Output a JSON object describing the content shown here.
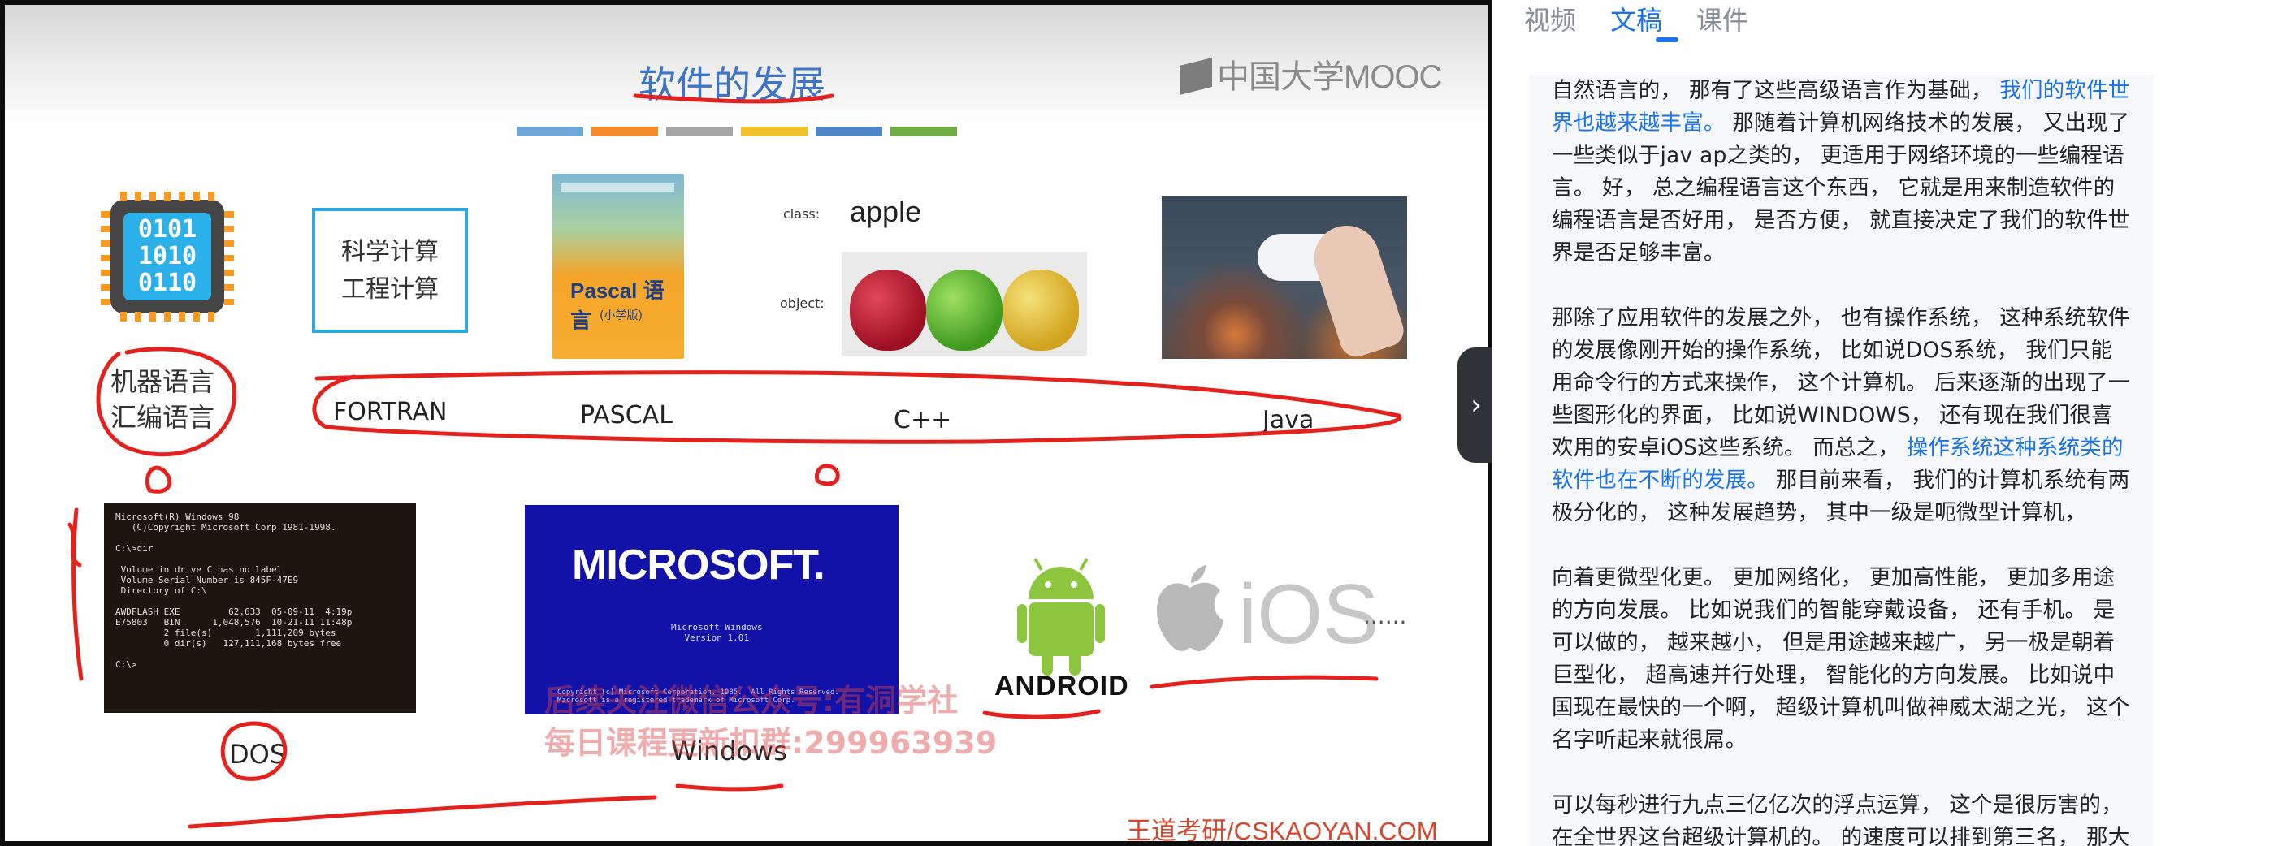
{
  "slide": {
    "title": "软件的发展",
    "logo_text": "中国大学MOOC",
    "color_bars": [
      "#6fa6d8",
      "#f28c28",
      "#a6a6a6",
      "#f2c12e",
      "#4f86c6",
      "#70ad47"
    ],
    "chip_binary": [
      "0101",
      "1010",
      "0110"
    ],
    "sci_box_lines": [
      "科学计算",
      "工程计算"
    ],
    "book_title": "Pascal 语言",
    "book_subtitle": "(小学版)",
    "class_label": "class:",
    "object_label": "object:",
    "apple_word": "apple",
    "machine_lang_lines": [
      "机器语言",
      "汇编语言"
    ],
    "languages": [
      "FORTRAN",
      "PASCAL",
      "C++",
      "Java"
    ],
    "dos_screen_text": "Microsoft(R) Windows 98\n   (C)Copyright Microsoft Corp 1981-1998.\n\nC:\\>dir\n\n Volume in drive C has no label\n Volume Serial Number is 845F-47E9\n Directory of C:\\\n\nAWDFLASH EXE         62,633  05-09-11  4:19p\nE75803   BIN      1,048,576  10-21-11 11:48p\n         2 file(s)        1,111,209 bytes\n         0 dir(s)   127,111,168 bytes free\n\nC:\\>",
    "ms_logo": "MICROSOFT.",
    "ms_sub": "Microsoft Windows\nVersion 1.01",
    "ms_copy": "Copyright (c) Microsoft Corporation, 1985.  All Rights Reserved.\nMicrosoft is a registered trademark of Microsoft Corp.",
    "android_word": "ANDROID",
    "ios_word": "iOS",
    "ellipsis": "......",
    "label_dos": "DOS",
    "label_windows": "Windows",
    "watermark_lines": [
      "后续关注微信公众号:有洞学社",
      "每日课程更新扣群:299963939"
    ],
    "footer_credit": "王道考研/CSKAOYAN.COM",
    "toggle_icon": "›"
  },
  "side": {
    "tabs": [
      "视频",
      "文稿",
      "课件"
    ],
    "active_tab": "文稿",
    "paragraphs": [
      [
        {
          "t": "自然语言的， 那有了这些高级语言作为基础， "
        },
        {
          "t": "我们的软件世界也越来越丰富。",
          "hl": true
        },
        {
          "t": " 那随着计算机网络技术的发展， 又出现了一些类似于jav ap之类的， 更适用于网络环境的一些编程语言。 好， 总之编程语言这个东西， 它就是用来制造软件的编程语言是否好用， 是否方便， 就直接决定了我们的软件世界是否足够丰富。"
        }
      ],
      [
        {
          "t": "那除了应用软件的发展之外， 也有操作系统， 这种系统软件的发展像刚开始的操作系统， 比如说DOS系统， 我们只能用命令行的方式来操作， 这个计算机。 后来逐渐的出现了一些图形化的界面， 比如说WINDOWS， 还有现在我们很喜欢用的安卓iOS这些系统。 而总之， "
        },
        {
          "t": "操作系统这种系统类的软件也在不断的发展。",
          "hl": true
        },
        {
          "t": " 那目前来看， 我们的计算机系统有两极分化的， 这种发展趋势， 其中一级是呃微型计算机，"
        }
      ],
      [
        {
          "t": "向着更微型化更。 更加网络化， 更加高性能， 更加多用途的方向发展。 比如说我们的智能穿戴设备， 还有手机。 是可以做的， 越来越小， 但是用途越来越广， 另一极是朝着巨型化， 超高速并行处理， 智能化的方向发展。 比如说中国现在最快的一个啊， 超级计算机叫做神威太湖之光， 这个名字听起来就很屌。"
        }
      ],
      [
        {
          "t": "可以每秒进行九点三亿亿次的浮点运算， 这个是很厉害的， 在全世界这台超级计算机的。 的速度可以排到第三名， 那大家如"
        }
      ]
    ]
  }
}
